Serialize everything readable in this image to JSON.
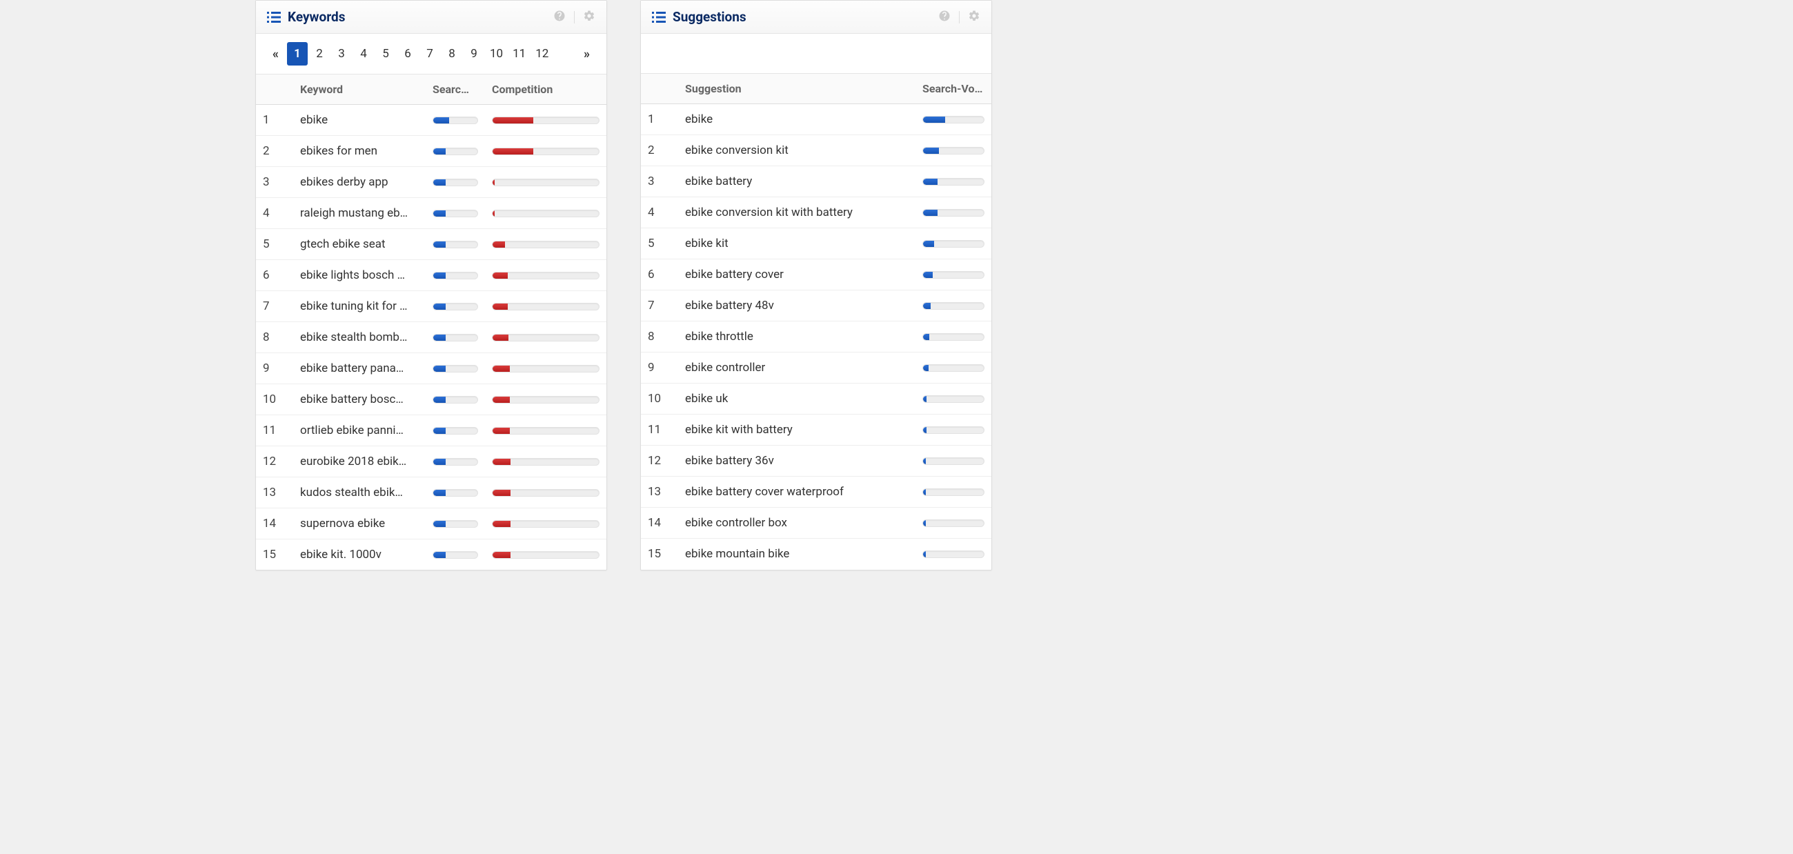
{
  "keywords_panel": {
    "title": "Keywords",
    "pagination": {
      "active": "1",
      "pages": [
        "1",
        "2",
        "3",
        "4",
        "5",
        "6",
        "7",
        "8",
        "9",
        "10",
        "11",
        "12"
      ]
    },
    "columns": {
      "index": "",
      "keyword": "Keyword",
      "search": "Searc…",
      "competition": "Competition"
    },
    "rows": [
      {
        "idx": "1",
        "keyword": "ebike",
        "search_pct": 36,
        "competition_pct": 38
      },
      {
        "idx": "2",
        "keyword": "ebikes for men",
        "search_pct": 28,
        "competition_pct": 38
      },
      {
        "idx": "3",
        "keyword": "ebikes derby app",
        "search_pct": 28,
        "competition_pct": 2
      },
      {
        "idx": "4",
        "keyword": "raleigh mustang eb…",
        "search_pct": 28,
        "competition_pct": 2
      },
      {
        "idx": "5",
        "keyword": "gtech ebike seat",
        "search_pct": 28,
        "competition_pct": 12
      },
      {
        "idx": "6",
        "keyword": "ebike lights bosch …",
        "search_pct": 28,
        "competition_pct": 14
      },
      {
        "idx": "7",
        "keyword": "ebike tuning kit for …",
        "search_pct": 28,
        "competition_pct": 14
      },
      {
        "idx": "8",
        "keyword": "ebike stealth bomb…",
        "search_pct": 28,
        "competition_pct": 15
      },
      {
        "idx": "9",
        "keyword": "ebike battery pana…",
        "search_pct": 28,
        "competition_pct": 16
      },
      {
        "idx": "10",
        "keyword": "ebike battery bosc…",
        "search_pct": 28,
        "competition_pct": 16
      },
      {
        "idx": "11",
        "keyword": "ortlieb ebike panni…",
        "search_pct": 28,
        "competition_pct": 16
      },
      {
        "idx": "12",
        "keyword": "eurobike 2018 ebik…",
        "search_pct": 28,
        "competition_pct": 17
      },
      {
        "idx": "13",
        "keyword": "kudos stealth ebik…",
        "search_pct": 28,
        "competition_pct": 17
      },
      {
        "idx": "14",
        "keyword": "supernova ebike",
        "search_pct": 28,
        "competition_pct": 17
      },
      {
        "idx": "15",
        "keyword": "ebike kit. 1000v",
        "search_pct": 28,
        "competition_pct": 17
      }
    ]
  },
  "suggestions_panel": {
    "title": "Suggestions",
    "columns": {
      "index": "",
      "suggestion": "Suggestion",
      "search": "Search-Vo…"
    },
    "rows": [
      {
        "idx": "1",
        "suggestion": "ebike",
        "search_pct": 36
      },
      {
        "idx": "2",
        "suggestion": "ebike conversion kit",
        "search_pct": 26
      },
      {
        "idx": "3",
        "suggestion": "ebike battery",
        "search_pct": 24
      },
      {
        "idx": "4",
        "suggestion": "ebike conversion kit with battery",
        "search_pct": 24
      },
      {
        "idx": "5",
        "suggestion": "ebike kit",
        "search_pct": 18
      },
      {
        "idx": "6",
        "suggestion": "ebike battery cover",
        "search_pct": 16
      },
      {
        "idx": "7",
        "suggestion": "ebike battery 48v",
        "search_pct": 13
      },
      {
        "idx": "8",
        "suggestion": "ebike throttle",
        "search_pct": 10
      },
      {
        "idx": "9",
        "suggestion": "ebike controller",
        "search_pct": 9
      },
      {
        "idx": "10",
        "suggestion": "ebike uk",
        "search_pct": 6
      },
      {
        "idx": "11",
        "suggestion": "ebike kit with battery",
        "search_pct": 6
      },
      {
        "idx": "12",
        "suggestion": "ebike battery 36v",
        "search_pct": 5
      },
      {
        "idx": "13",
        "suggestion": "ebike battery cover waterproof",
        "search_pct": 4
      },
      {
        "idx": "14",
        "suggestion": "ebike controller box",
        "search_pct": 4
      },
      {
        "idx": "15",
        "suggestion": "ebike mountain bike",
        "search_pct": 4
      }
    ]
  },
  "colors": {
    "blue": "#1755b5",
    "red": "#b91e1e"
  }
}
